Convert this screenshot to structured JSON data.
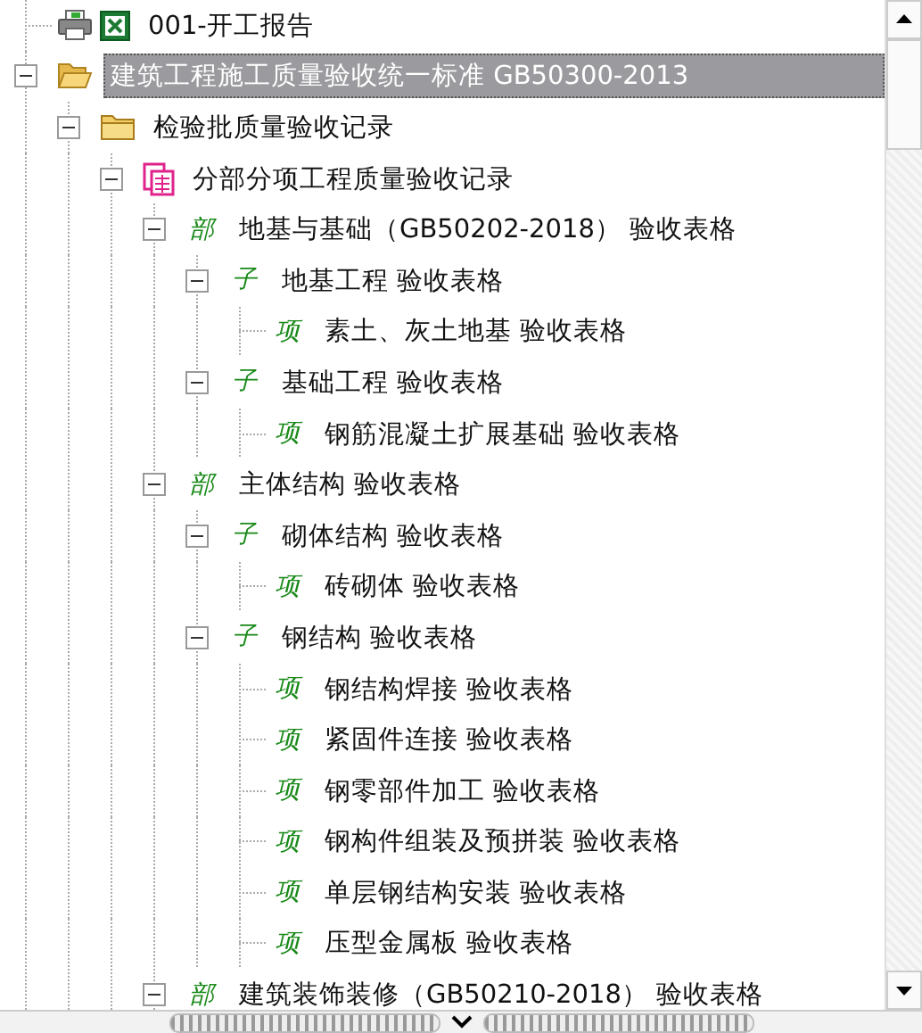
{
  "tree": [
    {
      "kind": "report",
      "label": "001-开工报告",
      "selected": false
    },
    {
      "kind": "folder-open",
      "label": "建筑工程施工质量验收统一标准 GB50300-2013",
      "selected": true,
      "expanded": true,
      "children": [
        {
          "kind": "folder",
          "label": "检验批质量验收记录",
          "selected": false,
          "expanded": true,
          "children": [
            {
              "kind": "form",
              "label": "分部分项工程质量验收记录",
              "selected": false,
              "expanded": true,
              "children": [
                {
                  "kind": "tagged",
                  "tag": "部",
                  "label": "地基与基础（GB50202-2018） 验收表格",
                  "selected": false,
                  "expanded": true,
                  "children": [
                    {
                      "kind": "tagged",
                      "tag": "子",
                      "label": "地基工程 验收表格",
                      "selected": false,
                      "expanded": true,
                      "children": [
                        {
                          "kind": "tagged",
                          "tag": "项",
                          "label": "素土、灰土地基 验收表格",
                          "selected": false
                        }
                      ]
                    },
                    {
                      "kind": "tagged",
                      "tag": "子",
                      "label": "基础工程 验收表格",
                      "selected": false,
                      "expanded": true,
                      "children": [
                        {
                          "kind": "tagged",
                          "tag": "项",
                          "label": "钢筋混凝土扩展基础 验收表格",
                          "selected": false
                        }
                      ]
                    }
                  ]
                },
                {
                  "kind": "tagged",
                  "tag": "部",
                  "label": "主体结构 验收表格",
                  "selected": false,
                  "expanded": true,
                  "children": [
                    {
                      "kind": "tagged",
                      "tag": "子",
                      "label": "砌体结构 验收表格",
                      "selected": false,
                      "expanded": true,
                      "children": [
                        {
                          "kind": "tagged",
                          "tag": "项",
                          "label": "砖砌体 验收表格",
                          "selected": false
                        }
                      ]
                    },
                    {
                      "kind": "tagged",
                      "tag": "子",
                      "label": "钢结构 验收表格",
                      "selected": false,
                      "expanded": true,
                      "children": [
                        {
                          "kind": "tagged",
                          "tag": "项",
                          "label": "钢结构焊接 验收表格",
                          "selected": false
                        },
                        {
                          "kind": "tagged",
                          "tag": "项",
                          "label": "紧固件连接 验收表格",
                          "selected": false
                        },
                        {
                          "kind": "tagged",
                          "tag": "项",
                          "label": "钢零部件加工 验收表格",
                          "selected": false
                        },
                        {
                          "kind": "tagged",
                          "tag": "项",
                          "label": "钢构件组装及预拼装 验收表格",
                          "selected": false
                        },
                        {
                          "kind": "tagged",
                          "tag": "项",
                          "label": "单层钢结构安装 验收表格",
                          "selected": false
                        },
                        {
                          "kind": "tagged",
                          "tag": "项",
                          "label": "压型金属板 验收表格",
                          "selected": false
                        }
                      ]
                    }
                  ]
                },
                {
                  "kind": "tagged",
                  "tag": "部",
                  "label": "建筑装饰装修（GB50210-2018） 验收表格",
                  "selected": false,
                  "expanded": true
                }
              ]
            }
          ]
        }
      ]
    }
  ]
}
